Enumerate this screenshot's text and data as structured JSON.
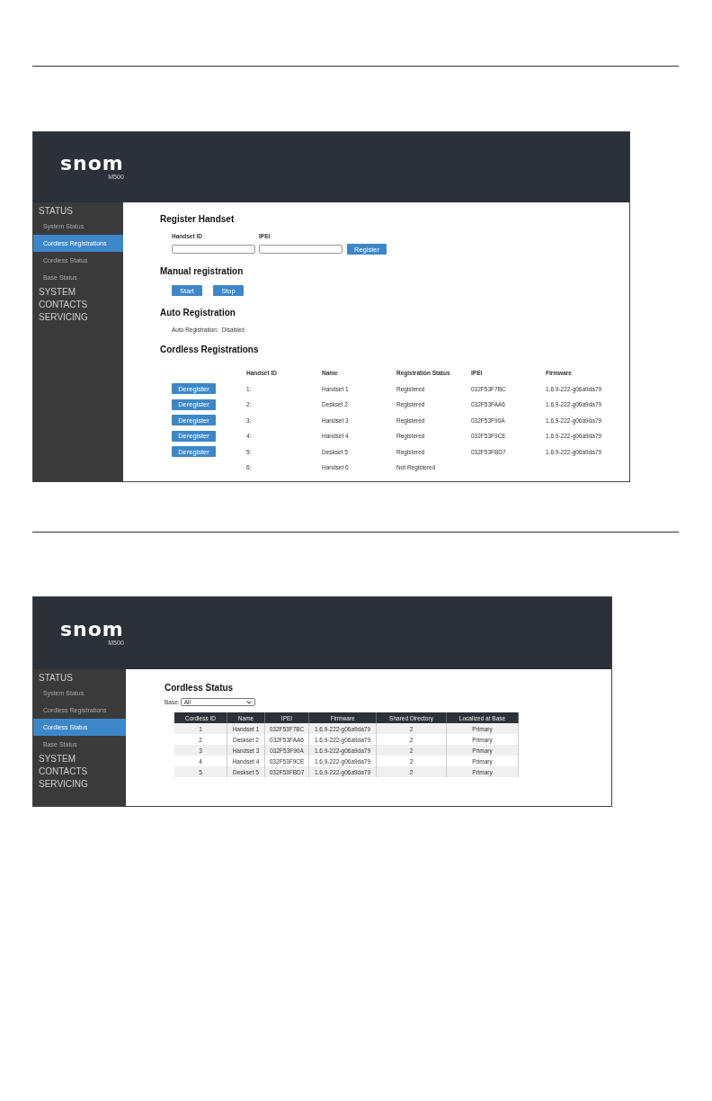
{
  "screens": [
    {
      "kind": "registrations",
      "logo": "snom",
      "model": "M500",
      "nav": [
        {
          "label": "STATUS",
          "children": [
            {
              "label": "System Status",
              "selected": false
            },
            {
              "label": "Cordless Registrations",
              "selected": true
            },
            {
              "label": "Cordless Status",
              "selected": false
            },
            {
              "label": "Base Status",
              "selected": false
            }
          ]
        },
        {
          "label": "SYSTEM"
        },
        {
          "label": "CONTACTS"
        },
        {
          "label": "SERVICING"
        }
      ],
      "register_handset": {
        "title": "Register Handset",
        "fields": [
          {
            "label": "Handset ID"
          },
          {
            "label": "IPEI"
          }
        ],
        "button": "Register"
      },
      "manual_registration": {
        "title": "Manual registration",
        "buttons": [
          "Start",
          "Stop"
        ]
      },
      "auto_registration": {
        "title": "Auto Registration",
        "label": "Auto Registration:",
        "value": "Disabled"
      },
      "cordless_registrations": {
        "title": "Cordless Registrations",
        "columns": [
          "Handset ID",
          "Name",
          "Registration Status",
          "IPEI",
          "Firmware"
        ],
        "rows": [
          {
            "action": "Deregister",
            "cells": [
              "1:",
              "Handset 1",
              "Registered",
              "032F53F7BC",
              "1.6.9-222-g06a9da79"
            ]
          },
          {
            "action": "Deregister",
            "cells": [
              "2:",
              "Deskset 2",
              "Registered",
              "032F53FAA6",
              "1.6.9-222-g06a9da79"
            ]
          },
          {
            "action": "Deregister",
            "cells": [
              "3:",
              "Handset 3",
              "Registered",
              "032F53F90A",
              "1.6.9-222-g06a9da79"
            ]
          },
          {
            "action": "Deregister",
            "cells": [
              "4:",
              "Handset 4",
              "Registered",
              "032F53F9CE",
              "1.6.9-222-g06a9da79"
            ]
          },
          {
            "action": "Deregister",
            "cells": [
              "5:",
              "Deskset 5",
              "Registered",
              "032F53FBD7",
              "1.6.9-222-g06a9da79"
            ]
          },
          {
            "cells": [
              "6:",
              "Handset 6",
              "Not Registered"
            ]
          }
        ]
      }
    },
    {
      "kind": "status",
      "logo": "snom",
      "model": "M500",
      "nav": [
        {
          "label": "STATUS",
          "children": [
            {
              "label": "System Status",
              "selected": false
            },
            {
              "label": "Cordless Registrations",
              "selected": false
            },
            {
              "label": "Cordless Status",
              "selected": true
            },
            {
              "label": "Base Status",
              "selected": false
            }
          ]
        },
        {
          "label": "SYSTEM"
        },
        {
          "label": "CONTACTS"
        },
        {
          "label": "SERVICING"
        }
      ],
      "title": "Cordless Status",
      "base": {
        "label": "Base:",
        "value": "All"
      },
      "table": {
        "columns": [
          "Cordless ID",
          "Name",
          "IPEI",
          "Firmware",
          "Shared Directory",
          "Localized at Base"
        ],
        "rows": [
          [
            "1",
            "Handset 1",
            "032F53F7BC",
            "1.6.9-222-g06a9da79",
            "2",
            "Primary"
          ],
          [
            "2",
            "Deskset 2",
            "032F53FAA6",
            "1.6.9-222-g06a9da79",
            "2",
            "Primary"
          ],
          [
            "3",
            "Handset 3",
            "032F53F90A",
            "1.6.9-222-g06a9da79",
            "2",
            "Primary"
          ],
          [
            "4",
            "Handset 4",
            "032F53F9CE",
            "1.6.9-222-g06a9da79",
            "2",
            "Primary"
          ],
          [
            "5",
            "Deskset 5",
            "032F53FBD7",
            "1.6.9-222-g06a9da79",
            "2",
            "Primary"
          ]
        ]
      }
    }
  ]
}
